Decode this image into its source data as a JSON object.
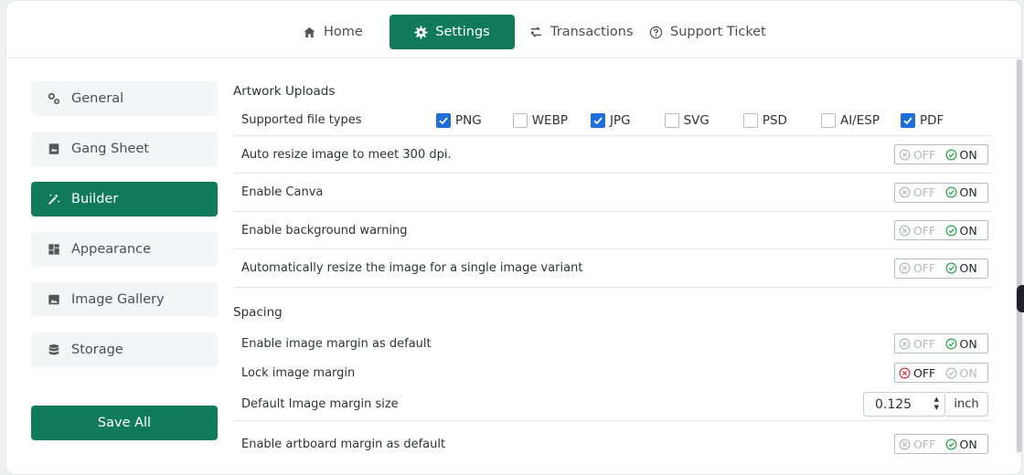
{
  "nav": {
    "tabs": [
      {
        "label": "Home",
        "icon": "home-icon"
      },
      {
        "label": "Settings",
        "icon": "gear-icon",
        "active": true
      },
      {
        "label": "Transactions",
        "icon": "transactions-icon"
      },
      {
        "label": "Support Ticket",
        "icon": "help-circle-icon"
      }
    ]
  },
  "sidebar": {
    "items": [
      {
        "label": "General",
        "icon": "gears-icon"
      },
      {
        "label": "Gang Sheet",
        "icon": "image-icon"
      },
      {
        "label": "Builder",
        "icon": "magic-wand-icon",
        "active": true
      },
      {
        "label": "Appearance",
        "icon": "dashboard-icon"
      },
      {
        "label": "Image Gallery",
        "icon": "picture-icon"
      },
      {
        "label": "Storage",
        "icon": "database-icon"
      }
    ],
    "save_label": "Save All"
  },
  "artwork": {
    "title": "Artwork Uploads",
    "file_types_label": "Supported file types",
    "file_types": [
      {
        "label": "PNG",
        "checked": true
      },
      {
        "label": "WEBP",
        "checked": false
      },
      {
        "label": "JPG",
        "checked": true
      },
      {
        "label": "SVG",
        "checked": false
      },
      {
        "label": "PSD",
        "checked": false
      },
      {
        "label": "AI/ESP",
        "checked": false
      },
      {
        "label": "PDF",
        "checked": true
      }
    ],
    "settings": [
      {
        "label": "Auto resize image to meet 300 dpi.",
        "value": "ON"
      },
      {
        "label": "Enable Canva",
        "value": "ON"
      },
      {
        "label": "Enable background warning",
        "value": "ON"
      },
      {
        "label": "Automatically resize the image for a single image variant",
        "value": "ON"
      }
    ]
  },
  "spacing": {
    "title": "Spacing",
    "image_margin_default": {
      "label": "Enable image margin as default",
      "value": "ON"
    },
    "lock_image_margin": {
      "label": "Lock image margin",
      "value": "OFF"
    },
    "margin_size": {
      "label": "Default Image margin size",
      "value": "0.125",
      "unit": "inch"
    },
    "artboard_margin_default": {
      "label": "Enable artboard margin as default",
      "value": "ON"
    }
  },
  "toggle_text": {
    "off": "OFF",
    "on": "ON"
  },
  "colors": {
    "primary": "#117a5b",
    "checkbox": "#1e6fd9",
    "on_icon": "#27a745",
    "off_icon": "#d9343a"
  }
}
